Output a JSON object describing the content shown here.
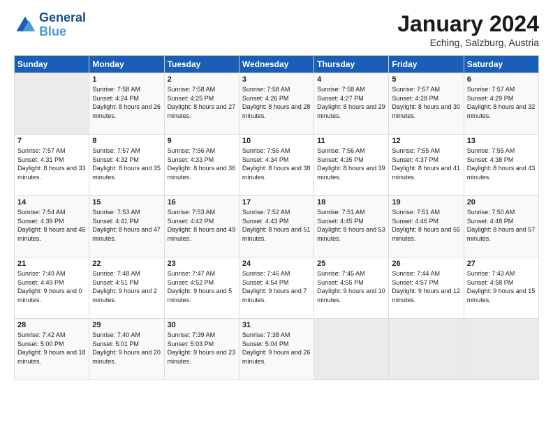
{
  "header": {
    "logo_line1": "General",
    "logo_line2": "Blue",
    "month": "January 2024",
    "location": "Eching, Salzburg, Austria"
  },
  "weekdays": [
    "Sunday",
    "Monday",
    "Tuesday",
    "Wednesday",
    "Thursday",
    "Friday",
    "Saturday"
  ],
  "weeks": [
    [
      {
        "num": "",
        "sunrise": "",
        "sunset": "",
        "daylight": "",
        "empty": true
      },
      {
        "num": "1",
        "sunrise": "Sunrise: 7:58 AM",
        "sunset": "Sunset: 4:24 PM",
        "daylight": "Daylight: 8 hours and 26 minutes."
      },
      {
        "num": "2",
        "sunrise": "Sunrise: 7:58 AM",
        "sunset": "Sunset: 4:25 PM",
        "daylight": "Daylight: 8 hours and 27 minutes."
      },
      {
        "num": "3",
        "sunrise": "Sunrise: 7:58 AM",
        "sunset": "Sunset: 4:26 PM",
        "daylight": "Daylight: 8 hours and 28 minutes."
      },
      {
        "num": "4",
        "sunrise": "Sunrise: 7:58 AM",
        "sunset": "Sunset: 4:27 PM",
        "daylight": "Daylight: 8 hours and 29 minutes."
      },
      {
        "num": "5",
        "sunrise": "Sunrise: 7:57 AM",
        "sunset": "Sunset: 4:28 PM",
        "daylight": "Daylight: 8 hours and 30 minutes."
      },
      {
        "num": "6",
        "sunrise": "Sunrise: 7:57 AM",
        "sunset": "Sunset: 4:29 PM",
        "daylight": "Daylight: 8 hours and 32 minutes."
      }
    ],
    [
      {
        "num": "7",
        "sunrise": "Sunrise: 7:57 AM",
        "sunset": "Sunset: 4:31 PM",
        "daylight": "Daylight: 8 hours and 33 minutes."
      },
      {
        "num": "8",
        "sunrise": "Sunrise: 7:57 AM",
        "sunset": "Sunset: 4:32 PM",
        "daylight": "Daylight: 8 hours and 35 minutes."
      },
      {
        "num": "9",
        "sunrise": "Sunrise: 7:56 AM",
        "sunset": "Sunset: 4:33 PM",
        "daylight": "Daylight: 8 hours and 36 minutes."
      },
      {
        "num": "10",
        "sunrise": "Sunrise: 7:56 AM",
        "sunset": "Sunset: 4:34 PM",
        "daylight": "Daylight: 8 hours and 38 minutes."
      },
      {
        "num": "11",
        "sunrise": "Sunrise: 7:56 AM",
        "sunset": "Sunset: 4:35 PM",
        "daylight": "Daylight: 8 hours and 39 minutes."
      },
      {
        "num": "12",
        "sunrise": "Sunrise: 7:55 AM",
        "sunset": "Sunset: 4:37 PM",
        "daylight": "Daylight: 8 hours and 41 minutes."
      },
      {
        "num": "13",
        "sunrise": "Sunrise: 7:55 AM",
        "sunset": "Sunset: 4:38 PM",
        "daylight": "Daylight: 8 hours and 43 minutes."
      }
    ],
    [
      {
        "num": "14",
        "sunrise": "Sunrise: 7:54 AM",
        "sunset": "Sunset: 4:39 PM",
        "daylight": "Daylight: 8 hours and 45 minutes."
      },
      {
        "num": "15",
        "sunrise": "Sunrise: 7:53 AM",
        "sunset": "Sunset: 4:41 PM",
        "daylight": "Daylight: 8 hours and 47 minutes."
      },
      {
        "num": "16",
        "sunrise": "Sunrise: 7:53 AM",
        "sunset": "Sunset: 4:42 PM",
        "daylight": "Daylight: 8 hours and 49 minutes."
      },
      {
        "num": "17",
        "sunrise": "Sunrise: 7:52 AM",
        "sunset": "Sunset: 4:43 PM",
        "daylight": "Daylight: 8 hours and 51 minutes."
      },
      {
        "num": "18",
        "sunrise": "Sunrise: 7:51 AM",
        "sunset": "Sunset: 4:45 PM",
        "daylight": "Daylight: 8 hours and 53 minutes."
      },
      {
        "num": "19",
        "sunrise": "Sunrise: 7:51 AM",
        "sunset": "Sunset: 4:46 PM",
        "daylight": "Daylight: 8 hours and 55 minutes."
      },
      {
        "num": "20",
        "sunrise": "Sunrise: 7:50 AM",
        "sunset": "Sunset: 4:48 PM",
        "daylight": "Daylight: 8 hours and 57 minutes."
      }
    ],
    [
      {
        "num": "21",
        "sunrise": "Sunrise: 7:49 AM",
        "sunset": "Sunset: 4:49 PM",
        "daylight": "Daylight: 9 hours and 0 minutes."
      },
      {
        "num": "22",
        "sunrise": "Sunrise: 7:48 AM",
        "sunset": "Sunset: 4:51 PM",
        "daylight": "Daylight: 9 hours and 2 minutes."
      },
      {
        "num": "23",
        "sunrise": "Sunrise: 7:47 AM",
        "sunset": "Sunset: 4:52 PM",
        "daylight": "Daylight: 9 hours and 5 minutes."
      },
      {
        "num": "24",
        "sunrise": "Sunrise: 7:46 AM",
        "sunset": "Sunset: 4:54 PM",
        "daylight": "Daylight: 9 hours and 7 minutes."
      },
      {
        "num": "25",
        "sunrise": "Sunrise: 7:45 AM",
        "sunset": "Sunset: 4:55 PM",
        "daylight": "Daylight: 9 hours and 10 minutes."
      },
      {
        "num": "26",
        "sunrise": "Sunrise: 7:44 AM",
        "sunset": "Sunset: 4:57 PM",
        "daylight": "Daylight: 9 hours and 12 minutes."
      },
      {
        "num": "27",
        "sunrise": "Sunrise: 7:43 AM",
        "sunset": "Sunset: 4:58 PM",
        "daylight": "Daylight: 9 hours and 15 minutes."
      }
    ],
    [
      {
        "num": "28",
        "sunrise": "Sunrise: 7:42 AM",
        "sunset": "Sunset: 5:00 PM",
        "daylight": "Daylight: 9 hours and 18 minutes."
      },
      {
        "num": "29",
        "sunrise": "Sunrise: 7:40 AM",
        "sunset": "Sunset: 5:01 PM",
        "daylight": "Daylight: 9 hours and 20 minutes."
      },
      {
        "num": "30",
        "sunrise": "Sunrise: 7:39 AM",
        "sunset": "Sunset: 5:03 PM",
        "daylight": "Daylight: 9 hours and 23 minutes."
      },
      {
        "num": "31",
        "sunrise": "Sunrise: 7:38 AM",
        "sunset": "Sunset: 5:04 PM",
        "daylight": "Daylight: 9 hours and 26 minutes."
      },
      {
        "num": "",
        "sunrise": "",
        "sunset": "",
        "daylight": "",
        "empty": true
      },
      {
        "num": "",
        "sunrise": "",
        "sunset": "",
        "daylight": "",
        "empty": true
      },
      {
        "num": "",
        "sunrise": "",
        "sunset": "",
        "daylight": "",
        "empty": true
      }
    ]
  ]
}
